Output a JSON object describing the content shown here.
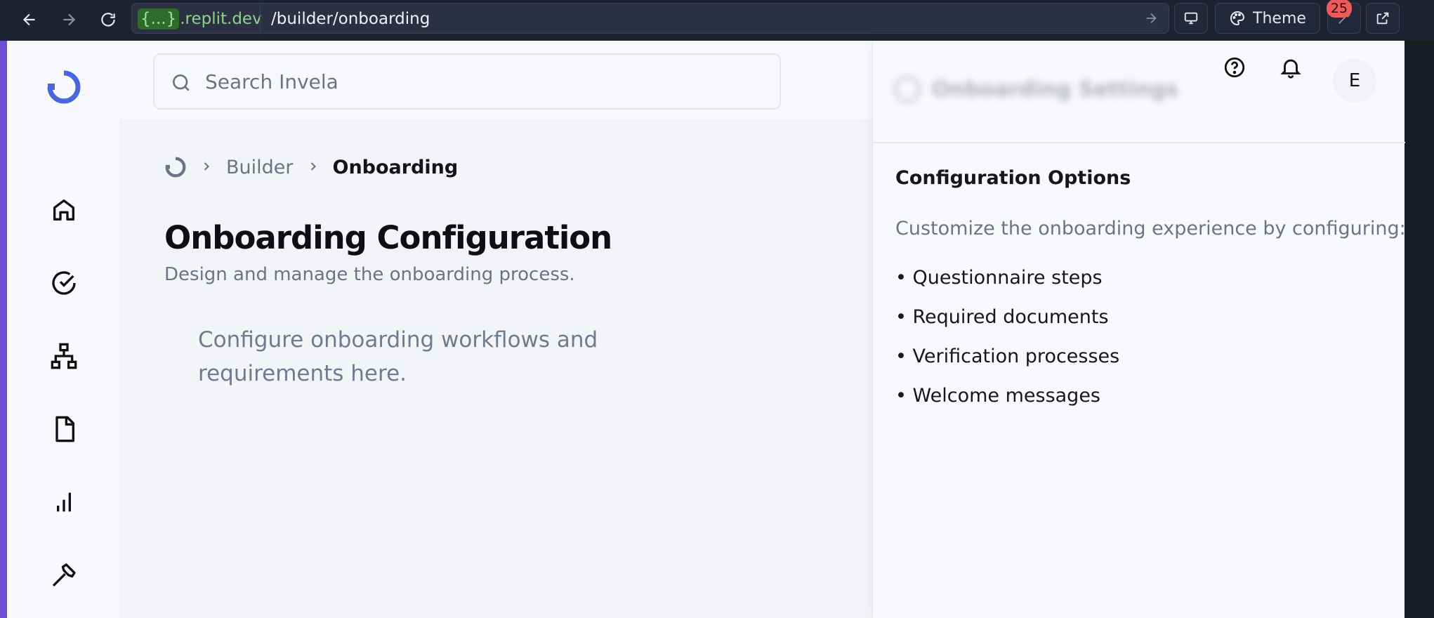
{
  "browser": {
    "host_brace": "{...}",
    "host": ".replit.dev",
    "path": "/builder/onboarding",
    "theme_label": "Theme",
    "notification_count": "25"
  },
  "search": {
    "placeholder": "Search Invela"
  },
  "breadcrumb": {
    "items": [
      "Builder",
      "Onboarding"
    ]
  },
  "page": {
    "title": "Onboarding Configuration",
    "subtitle": "Design and manage the onboarding process.",
    "body": "Configure onboarding workflows and requirements here."
  },
  "panel": {
    "header": "Onboarding Settings",
    "title": "Configuration Options",
    "description": "Customize the onboarding experience by configuring:",
    "items": [
      "• Questionnaire steps",
      "• Required documents",
      "• Verification processes",
      "• Welcome messages"
    ]
  },
  "user": {
    "initial": "E"
  },
  "colors": {
    "brand": "#4965e0",
    "frame": "#6b4fd4",
    "badge": "#ef5a5a"
  },
  "sidebar": {
    "icons": [
      "home-icon",
      "check-circle-icon",
      "network-icon",
      "file-icon",
      "bar-chart-icon",
      "hammer-icon"
    ]
  }
}
